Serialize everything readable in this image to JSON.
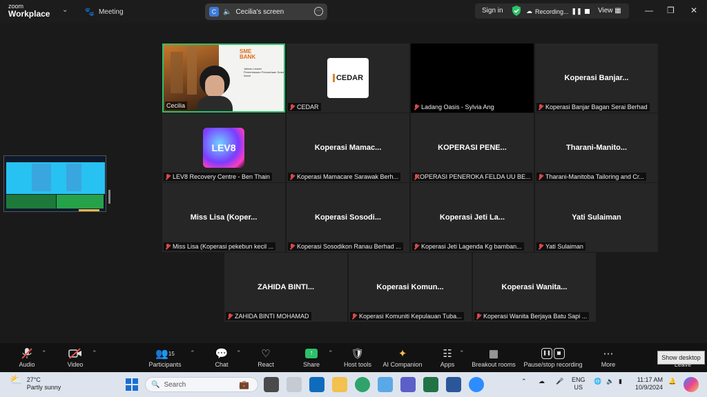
{
  "app": {
    "logo_line1": "zoom",
    "logo_line2": "Workplace",
    "meeting_label": "Meeting"
  },
  "share": {
    "badge": "C",
    "title": "Cecilia's screen"
  },
  "topbar": {
    "sign_in": "Sign in",
    "recording": "Recording...",
    "view": "View"
  },
  "tiles": [
    {
      "name": "",
      "label": "Cecilia",
      "kind": "video"
    },
    {
      "name": "",
      "label": "CEDAR",
      "kind": "logo-cedar"
    },
    {
      "name": "",
      "label": "Ladang Oasis - Sylvia Ang",
      "kind": "black"
    },
    {
      "name": "Koperasi Banjar...",
      "label": "Koperasi Banjar Bagan Serai Berhad"
    },
    {
      "name": "",
      "label": "LEV8 Recovery Centre - Ben Thain",
      "kind": "logo-lev8"
    },
    {
      "name": "Koperasi Mamac...",
      "label": "Koperasi Mamacare Sarawak Berh..."
    },
    {
      "name": "KOPERASI PENE...",
      "label": "KOPERASI PENEROKA FELDA UU BE..."
    },
    {
      "name": "Tharani-Manito...",
      "label": "Tharani-Manitoba Tailoring and Cr..."
    },
    {
      "name": "Miss Lisa (Koper...",
      "label": "Miss Lisa (Koperasi pekebun kecil ..."
    },
    {
      "name": "Koperasi Sosodi...",
      "label": "Koperasi Sosodikon Ranau Berhad ..."
    },
    {
      "name": "Koperasi Jeti La...",
      "label": "Koperasi Jeti Lagenda Kg bamban..."
    },
    {
      "name": "Yati Sulaiman",
      "label": "Yati Sulaiman"
    },
    {
      "name": "ZAHIDA BINTI...",
      "label": "ZAHIDA BINTI MOHAMAD"
    },
    {
      "name": "Koperasi Komun...",
      "label": "Koperasi Komuniti Kepulauan Tuba..."
    },
    {
      "name": "Koperasi Wanita...",
      "label": "Koperasi Wanita Berjaya Batu Sapi ..."
    }
  ],
  "slide": {
    "brand1": "SME",
    "brand2": "BANK",
    "line1": "Jalinan Lestari",
    "line2": "Pemerkasaan Perusahaan Sosial Awan"
  },
  "logos": {
    "cedar": "CEDAR",
    "lev8": "LEV8"
  },
  "toolbar": {
    "audio": "Audio",
    "video": "Video",
    "participants": "Participants",
    "participants_count": "15",
    "chat": "Chat",
    "react": "React",
    "share": "Share",
    "host_tools": "Host tools",
    "ai_companion": "AI Companion",
    "apps": "Apps",
    "breakout": "Breakout rooms",
    "record": "Pause/stop recording",
    "more": "More",
    "leave": "Leave"
  },
  "show_desktop": "Show desktop",
  "taskbar": {
    "temp": "27°C",
    "weather": "Partly sunny",
    "search": "Search",
    "lang1": "ENG",
    "lang2": "US",
    "time": "11:17 AM",
    "date": "10/9/2024"
  },
  "colors": {
    "active_border": "#2cc16a",
    "muted_mic": "#d94a4a",
    "share_green": "#2cc16a"
  }
}
